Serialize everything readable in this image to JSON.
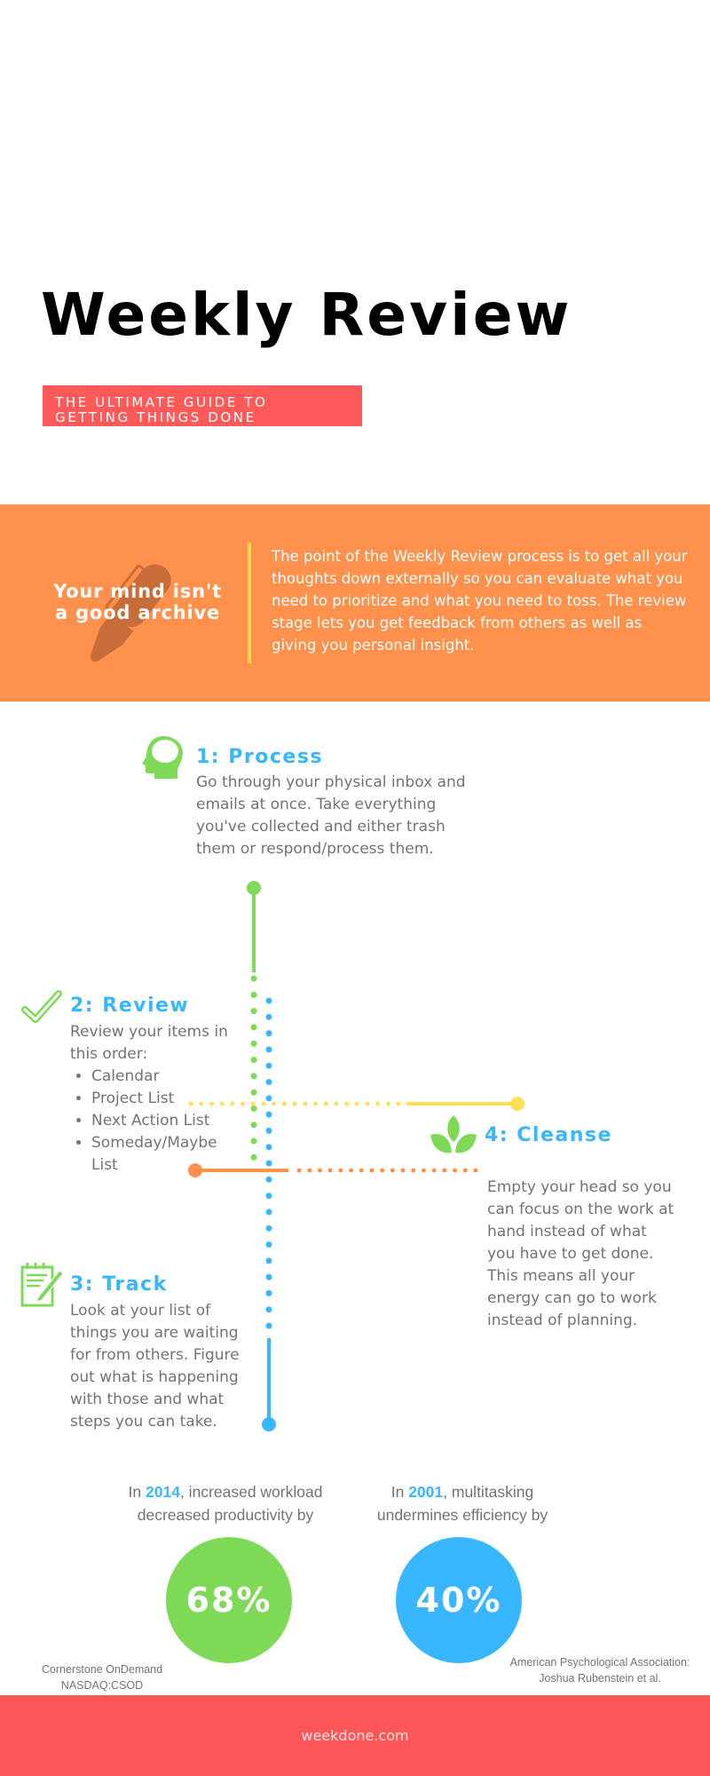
{
  "header": {
    "title": "Weekly Review",
    "subtitle_line1": "THE ULTIMATE GUIDE TO",
    "subtitle_line2": "GETTING THINGS DONE"
  },
  "intro": {
    "tagline_line1": "Your mind isn't",
    "tagline_line2": "a good archive",
    "icon": "pen-icon",
    "text": "The point of the Weekly Review process is to get all your thoughts down externally so you can evaluate what you need to prioritize and what you need to toss. The review stage lets you get feedback from others as well as giving you personal insight."
  },
  "steps": [
    {
      "heading": "1: Process",
      "icon": "head-icon",
      "body": "Go through your physical inbox and emails at once. Take everything you've collected and either trash them or respond/process them."
    },
    {
      "heading": "2: Review",
      "icon": "checkmark-icon",
      "body": "Review your items in this order:",
      "list": [
        "Calendar",
        "Project List",
        "Next Action List",
        "Someday/Maybe List"
      ]
    },
    {
      "heading": "3: Track",
      "icon": "notepad-pencil-icon",
      "body": "Look at your list of things you are waiting for from others. Figure out what is happening with those and what steps you can take."
    },
    {
      "heading": "4: Cleanse",
      "icon": "sprout-icon",
      "body": "Empty your head so you can focus on the work at hand instead of what you have to get done. This means all your energy can go to work instead of planning."
    }
  ],
  "stats": [
    {
      "prefix": "In ",
      "year": "2014",
      "suffix": ", increased workload",
      "line2": "decreased productivity by",
      "value": "68%",
      "color": "#7ed957",
      "source_line1": "Cornerstone OnDemand",
      "source_line2": "NASDAQ:CSOD"
    },
    {
      "prefix": "In ",
      "year": "2001",
      "suffix": ", multitasking",
      "line2": "undermines efficiency by",
      "value": "40%",
      "color": "#38b6ff",
      "source_line1": "American Psychological Association:",
      "source_line2": "Joshua Rubenstein et al."
    }
  ],
  "footer": {
    "text": "weekdone.com"
  },
  "colors": {
    "accent_blue": "#38b6ff",
    "accent_green": "#7ed957",
    "accent_orange": "#ff914d",
    "accent_yellow": "#ffde59",
    "accent_red": "#ff5757",
    "body_text": "#737373"
  }
}
